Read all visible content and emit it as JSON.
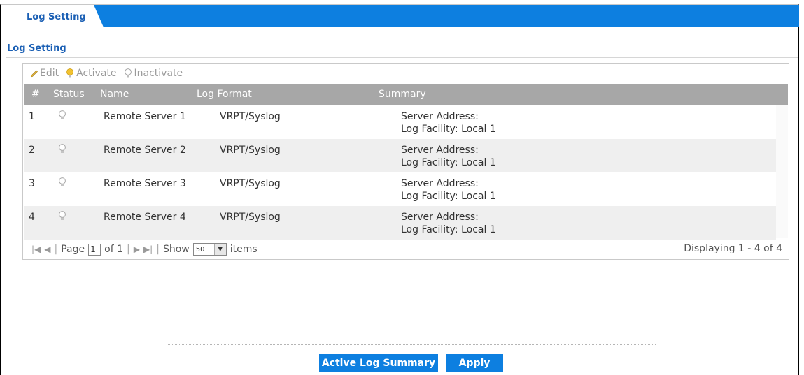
{
  "tab": {
    "label": "Log Setting"
  },
  "section": {
    "title": "Log Setting"
  },
  "toolbar": {
    "edit": "Edit",
    "activate": "Activate",
    "inactivate": "Inactivate"
  },
  "table": {
    "headers": [
      "#",
      "Status",
      "Name",
      "Log Format",
      "Summary"
    ],
    "rows": [
      {
        "index": "1",
        "status": "inactive",
        "name": "Remote Server 1",
        "format": "VRPT/Syslog",
        "summary1": "Server Address:",
        "summary2": "Log Facility: Local 1"
      },
      {
        "index": "2",
        "status": "inactive",
        "name": "Remote Server 2",
        "format": "VRPT/Syslog",
        "summary1": "Server Address:",
        "summary2": "Log Facility: Local 1"
      },
      {
        "index": "3",
        "status": "inactive",
        "name": "Remote Server 3",
        "format": "VRPT/Syslog",
        "summary1": "Server Address:",
        "summary2": "Log Facility: Local 1"
      },
      {
        "index": "4",
        "status": "inactive",
        "name": "Remote Server 4",
        "format": "VRPT/Syslog",
        "summary1": "Server Address:",
        "summary2": "Log Facility: Local 1"
      }
    ]
  },
  "pager": {
    "page_label": "Page",
    "page_value": "1",
    "of_label": "of 1",
    "show_label": "Show",
    "show_value": "50",
    "items_label": "items",
    "displaying": "Displaying 1 - 4 of 4"
  },
  "buttons": {
    "active_log_summary": "Active Log Summary",
    "apply": "Apply"
  },
  "colors": {
    "accent": "#0d7fe0",
    "header": "#a7a7a7",
    "title": "#1a5fb4"
  }
}
